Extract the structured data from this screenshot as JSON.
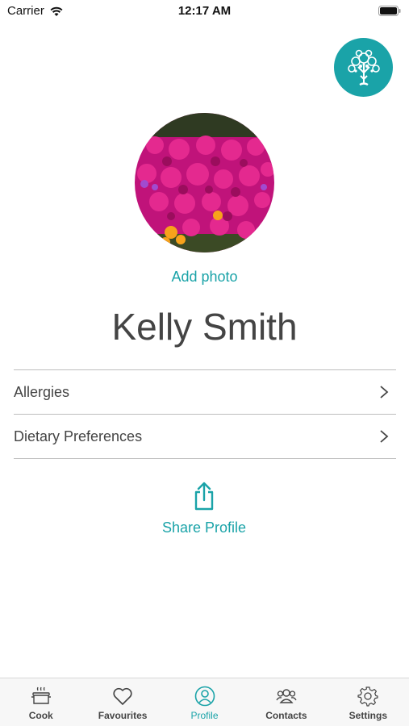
{
  "status_bar": {
    "carrier": "Carrier",
    "time": "12:17 AM"
  },
  "profile": {
    "add_photo_label": "Add photo",
    "name": "Kelly Smith"
  },
  "menu": {
    "items": [
      {
        "label": "Allergies"
      },
      {
        "label": "Dietary Preferences"
      }
    ]
  },
  "share": {
    "label": "Share Profile"
  },
  "tab_bar": {
    "tabs": [
      {
        "label": "Cook",
        "icon": "cooking-pot-icon"
      },
      {
        "label": "Favourites",
        "icon": "heart-icon"
      },
      {
        "label": "Profile",
        "icon": "profile-icon"
      },
      {
        "label": "Contacts",
        "icon": "contacts-icon"
      },
      {
        "label": "Settings",
        "icon": "gear-icon"
      }
    ],
    "active_tab": "Profile"
  },
  "colors": {
    "accent": "#1aa3a8",
    "text": "#444444",
    "divider": "#bdbdbd"
  }
}
